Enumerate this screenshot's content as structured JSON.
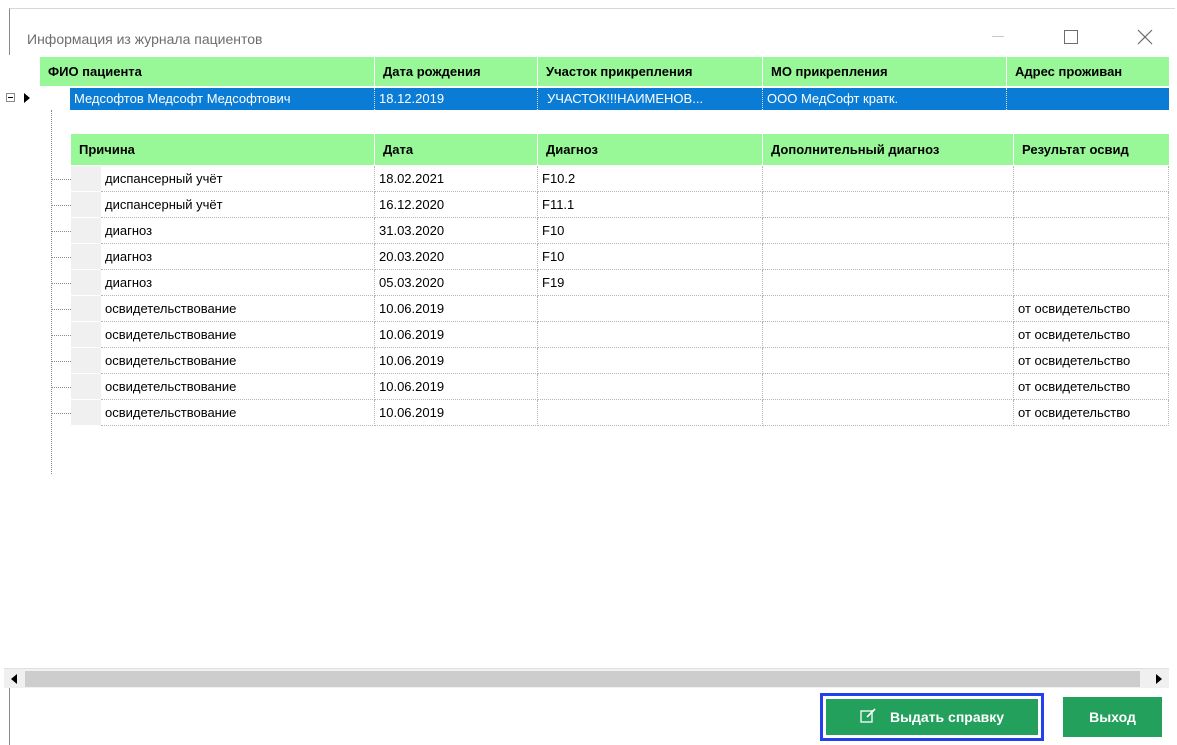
{
  "window": {
    "title": "Информация из журнала пациентов"
  },
  "patient_grid": {
    "columns": [
      "ФИО пациента",
      "Дата рождения",
      "Участок прикрепления",
      "МО прикрепления",
      "Адрес проживан"
    ],
    "row": {
      "name": "Медсофтов Медсофт  Медсофтович",
      "birth_date": "18.12.2019",
      "district": "УЧАСТОК!!!НАИМЕНОВ...",
      "mo": "ООО МедСофт  кратк.",
      "address": ""
    }
  },
  "detail_grid": {
    "columns": [
      "Причина",
      "Дата",
      "Диагноз",
      "Дополнительный диагноз",
      "Результат освид"
    ],
    "rows": [
      {
        "reason": "диспансерный учёт",
        "date": "18.02.2021",
        "diagnosis": "F10.2",
        "extra": "",
        "result": ""
      },
      {
        "reason": "диспансерный учёт",
        "date": "16.12.2020",
        "diagnosis": "F11.1",
        "extra": "",
        "result": ""
      },
      {
        "reason": "диагноз",
        "date": "31.03.2020",
        "diagnosis": "F10",
        "extra": "",
        "result": ""
      },
      {
        "reason": "диагноз",
        "date": "20.03.2020",
        "diagnosis": "F10",
        "extra": "",
        "result": ""
      },
      {
        "reason": "диагноз",
        "date": "05.03.2020",
        "diagnosis": "F19",
        "extra": "",
        "result": ""
      },
      {
        "reason": "освидетельствование",
        "date": "10.06.2019",
        "diagnosis": "",
        "extra": "",
        "result": "от освидетельство"
      },
      {
        "reason": "освидетельствование",
        "date": "10.06.2019",
        "diagnosis": "",
        "extra": "",
        "result": "от освидетельство"
      },
      {
        "reason": "освидетельствование",
        "date": "10.06.2019",
        "diagnosis": "",
        "extra": "",
        "result": "от освидетельство"
      },
      {
        "reason": "освидетельствование",
        "date": "10.06.2019",
        "diagnosis": "",
        "extra": "",
        "result": "от освидетельство"
      },
      {
        "reason": "освидетельствование",
        "date": "10.06.2019",
        "diagnosis": "",
        "extra": "",
        "result": "от освидетельство"
      }
    ]
  },
  "buttons": {
    "issue_label": "Выдать справку",
    "exit_label": "Выход"
  },
  "icons": {
    "minimize": "minimize-icon",
    "maximize": "maximize-icon",
    "close": "close-icon",
    "edit": "edit-icon",
    "scroll_left": "arrow-left-icon",
    "scroll_right": "arrow-right-icon"
  },
  "colors": {
    "header_green": "#98f898",
    "selection_blue": "#0a7cd6",
    "button_green": "#22a05c",
    "focus_border": "#2240ee"
  }
}
